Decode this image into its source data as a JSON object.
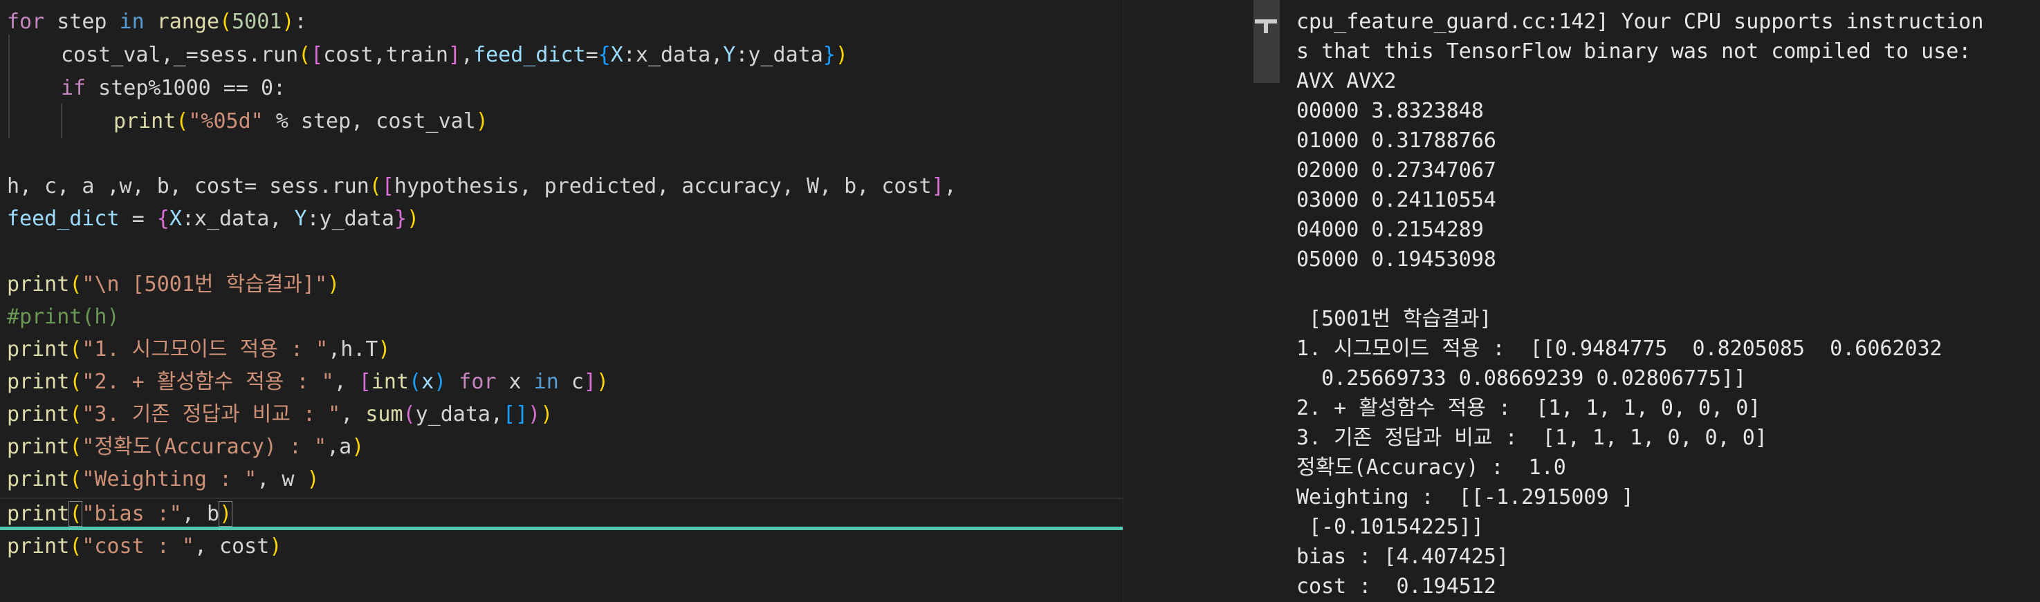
{
  "editor": {
    "line1": {
      "kw_for": "for",
      "var": " step ",
      "kw_in": "in",
      "sp": " ",
      "fn": "range",
      "p1": "(",
      "num": "5001",
      "p1c": ")",
      "tail": ":"
    },
    "line2": {
      "a": "cost_val,_=sess.run",
      "p1": "(",
      "p2": "[",
      "b": "cost,train",
      "p2c": "]",
      "c": ",",
      "kw": "feed_dict",
      "d": "=",
      "p3": "{",
      "e": "X",
      "f": ":x_data,",
      "g": "Y",
      "h": ":y_data",
      "p3c": "}",
      "p1c": ")"
    },
    "line3": {
      "kw_if": "if",
      "rest": " step%1000 == 0:"
    },
    "line4": {
      "fn": "print",
      "p1": "(",
      "str": "\"%05d\"",
      "rest": " % step, cost_val",
      "p1c": ")"
    },
    "line5": {
      "a": "h, c, a ,w, b, cost= sess.run",
      "p1": "(",
      "p2": "[",
      "b": "hypothesis, predicted, accuracy, W, b, cost",
      "p2c": "]",
      "c": ","
    },
    "line6": {
      "kw": "feed_dict",
      "a": " = ",
      "p1": "{",
      "b": "X",
      "c": ":x_data, ",
      "d": "Y",
      "e": ":y_data",
      "p1c": "}",
      "p0c": ")"
    },
    "line7": {
      "fn": "print",
      "p1": "(",
      "str": "\"\\n [5001번 학습결과]\"",
      "p1c": ")"
    },
    "line8": {
      "cmt": "#print(h)"
    },
    "line9": {
      "fn": "print",
      "p1": "(",
      "str": "\"1. 시그모이드 적용 : \"",
      "rest": ",h.T",
      "p1c": ")"
    },
    "line10": {
      "fn": "print",
      "p1": "(",
      "str": "\"2. + 활성함수 적용 : \"",
      "a": ", ",
      "p2": "[",
      "fn2": "int",
      "p3": "(",
      "b": "x",
      "p3c": ")",
      "kw_for": " for",
      "c": " x ",
      "kw_in": "in",
      "d": " c",
      "p2c": "]",
      "p1c": ")"
    },
    "line11": {
      "fn": "print",
      "p1": "(",
      "str": "\"3. 기존 정답과 비교 : \"",
      "a": ", ",
      "fn2": "sum",
      "p2": "(",
      "b": "y_data,",
      "p3": "[]",
      "p2c": ")",
      "p1c": ")"
    },
    "line12": {
      "fn": "print",
      "p1": "(",
      "str": "\"정확도(Accuracy) : \"",
      "rest": ",a",
      "p1c": ")"
    },
    "line13": {
      "fn": "print",
      "p1": "(",
      "str": "\"Weighting : \"",
      "rest": ", w ",
      "p1c": ")"
    },
    "line14": {
      "fn": "print",
      "p1": "(",
      "str": "\"bias :\"",
      "rest": ", b",
      "p1c": ")"
    },
    "line15": {
      "fn": "print",
      "p1": "(",
      "str": "\"cost : \"",
      "rest": ", cost",
      "p1c": ")"
    }
  },
  "terminal": {
    "lines": [
      "cpu_feature_guard.cc:142] Your CPU supports instruction",
      "s that this TensorFlow binary was not compiled to use:",
      "AVX AVX2",
      "00000 3.8323848",
      "01000 0.31788766",
      "02000 0.27347067",
      "03000 0.24110554",
      "04000 0.2154289",
      "05000 0.19453098",
      "",
      " [5001번 학습결과]",
      "1. 시그모이드 적용 :  [[0.9484775  0.8205085  0.6062032",
      "  0.25669733 0.08669239 0.02806775]]",
      "2. + 활성함수 적용 :  [1, 1, 1, 0, 0, 0]",
      "3. 기존 정답과 비교 :  [1, 1, 1, 0, 0, 0]",
      "정확도(Accuracy) :  1.0",
      "Weighting :  [[-1.2915009 ]",
      " [-0.10154225]]",
      "bias : [4.407425]",
      "cost :  0.194512"
    ]
  },
  "colors": {
    "background": "#1e1e1e",
    "cursor_line_accent": "#4ec9b0",
    "keyword": "#c586c0",
    "function": "#dcdcaa",
    "string": "#ce9178",
    "variable": "#9cdcfe",
    "comment": "#6a9955"
  },
  "icons": {
    "scrollbar_marker": "t-marker-icon"
  }
}
